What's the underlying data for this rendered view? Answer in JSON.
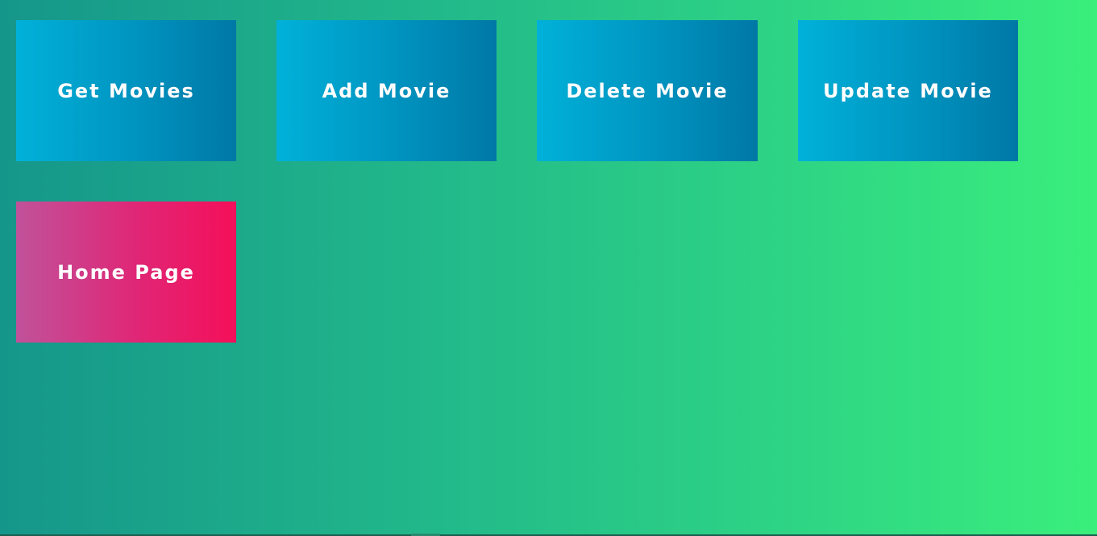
{
  "buttons": {
    "get_movies": "Get Movies",
    "add_movie": "Add Movie",
    "delete_movie": "Delete Movie",
    "update_movie": "Update Movie",
    "home_page": "Home Page"
  },
  "colors": {
    "background_start": "#15968a",
    "background_end": "#3aef7c",
    "action_tile_start": "#00b1d9",
    "action_tile_end": "#0078a6",
    "home_tile_start": "#c0529a",
    "home_tile_end": "#f50f59",
    "text": "#ffffff"
  }
}
